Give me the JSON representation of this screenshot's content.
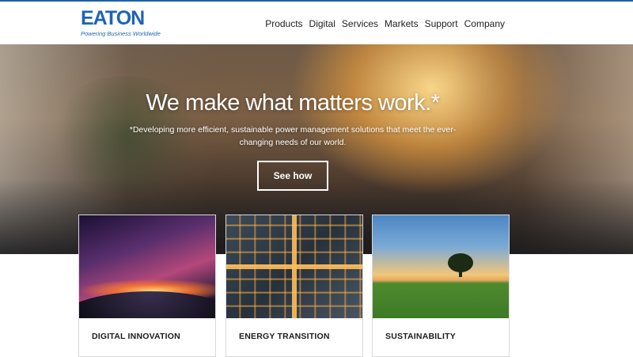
{
  "brand": {
    "name": "EATON",
    "tagline": "Powering Business Worldwide",
    "accent": "#1f63b3"
  },
  "nav": {
    "items": [
      {
        "label": "Products"
      },
      {
        "label": "Digital"
      },
      {
        "label": "Services"
      },
      {
        "label": "Markets"
      },
      {
        "label": "Support"
      },
      {
        "label": "Company"
      }
    ]
  },
  "hero": {
    "title": "We make what matters work.*",
    "subtitle": "*Developing more efficient, sustainable power management solutions that meet the ever-changing needs of our world.",
    "cta_label": "See how"
  },
  "cards": [
    {
      "label": "DIGITAL INNOVATION",
      "image": "earth-horizon-galaxy"
    },
    {
      "label": "ENERGY TRANSITION",
      "image": "city-aerial-night"
    },
    {
      "label": "SUSTAINABILITY",
      "image": "tree-field-sunset"
    }
  ]
}
